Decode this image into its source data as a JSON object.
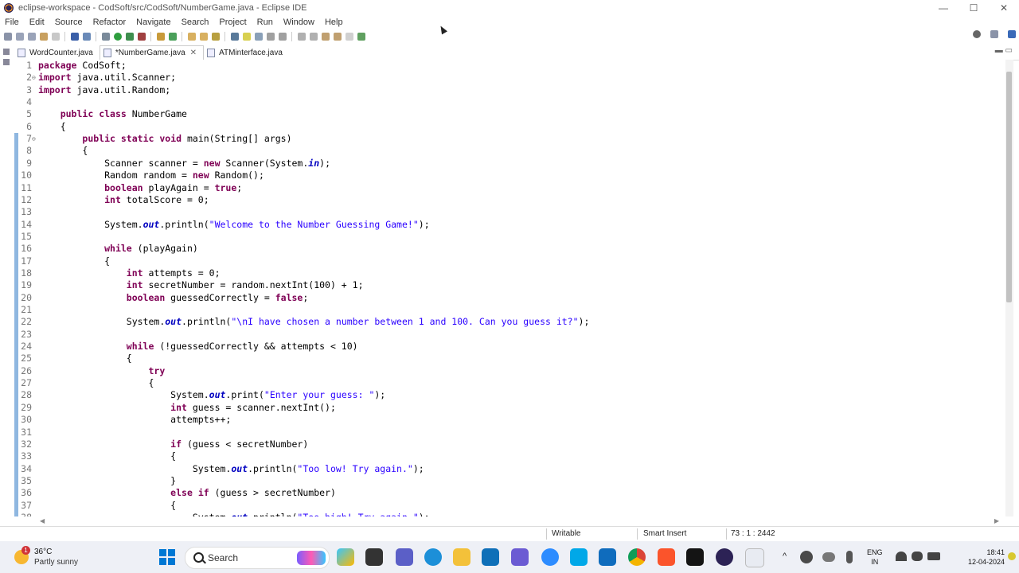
{
  "window": {
    "title": "eclipse-workspace - CodSoft/src/CodSoft/NumberGame.java - Eclipse IDE",
    "minimize": "—",
    "maximize": "☐",
    "close": "✕"
  },
  "menu": [
    "File",
    "Edit",
    "Source",
    "Refactor",
    "Navigate",
    "Search",
    "Project",
    "Run",
    "Window",
    "Help"
  ],
  "tabs": [
    {
      "label": "WordCounter.java",
      "active": false
    },
    {
      "label": "*NumberGame.java",
      "active": true
    },
    {
      "label": "ATMinterface.java",
      "active": false
    }
  ],
  "tab_close": "✕",
  "view_controls": "▬ ▭",
  "code": [
    {
      "n": "1",
      "t": "package CodSoft;"
    },
    {
      "n": "2",
      "f": "⊖",
      "t": "import java.util.Scanner;"
    },
    {
      "n": "3",
      "t": "import java.util.Random;"
    },
    {
      "n": "4",
      "t": ""
    },
    {
      "n": "5",
      "t": "    public class NumberGame"
    },
    {
      "n": "6",
      "t": "    {"
    },
    {
      "n": "7",
      "f": "⊖",
      "t": "        public static void main(String[] args)"
    },
    {
      "n": "8",
      "t": "        {"
    },
    {
      "n": "9",
      "t": "            Scanner scanner = new Scanner(System.in);"
    },
    {
      "n": "10",
      "t": "            Random random = new Random();"
    },
    {
      "n": "11",
      "t": "            boolean playAgain = true;"
    },
    {
      "n": "12",
      "t": "            int totalScore = 0;"
    },
    {
      "n": "13",
      "t": ""
    },
    {
      "n": "14",
      "t": "            System.out.println(\"Welcome to the Number Guessing Game!\");"
    },
    {
      "n": "15",
      "t": ""
    },
    {
      "n": "16",
      "t": "            while (playAgain)"
    },
    {
      "n": "17",
      "t": "            {"
    },
    {
      "n": "18",
      "t": "                int attempts = 0;"
    },
    {
      "n": "19",
      "t": "                int secretNumber = random.nextInt(100) + 1;"
    },
    {
      "n": "20",
      "t": "                boolean guessedCorrectly = false;"
    },
    {
      "n": "21",
      "t": ""
    },
    {
      "n": "22",
      "t": "                System.out.println(\"\\nI have chosen a number between 1 and 100. Can you guess it?\");"
    },
    {
      "n": "23",
      "t": ""
    },
    {
      "n": "24",
      "t": "                while (!guessedCorrectly && attempts < 10)"
    },
    {
      "n": "25",
      "t": "                {"
    },
    {
      "n": "26",
      "t": "                    try"
    },
    {
      "n": "27",
      "t": "                    {"
    },
    {
      "n": "28",
      "t": "                        System.out.print(\"Enter your guess: \");"
    },
    {
      "n": "29",
      "t": "                        int guess = scanner.nextInt();"
    },
    {
      "n": "30",
      "t": "                        attempts++;"
    },
    {
      "n": "31",
      "t": ""
    },
    {
      "n": "32",
      "t": "                        if (guess < secretNumber)"
    },
    {
      "n": "33",
      "t": "                        {"
    },
    {
      "n": "34",
      "t": "                            System.out.println(\"Too low! Try again.\");"
    },
    {
      "n": "35",
      "t": "                        }"
    },
    {
      "n": "36",
      "t": "                        else if (guess > secretNumber)"
    },
    {
      "n": "37",
      "t": "                        {"
    },
    {
      "n": "38",
      "t": "                            System.out.println(\"Too high! Try again.\");"
    }
  ],
  "status": {
    "mode": "Writable",
    "insert": "Smart Insert",
    "position": "73 : 1 : 2442"
  },
  "weather": {
    "temp": "36°C",
    "desc": "Partly sunny",
    "badge": "1"
  },
  "taskbar": {
    "search": "Search"
  },
  "tray": {
    "lang1": "ENG",
    "lang2": "IN",
    "time": "18:41",
    "date": "12-04-2024",
    "chevron": "^"
  },
  "colors": {
    "keyword": "#7f0055",
    "string": "#2a00ff",
    "field": "#0000c0",
    "accent": "#0078d4"
  }
}
